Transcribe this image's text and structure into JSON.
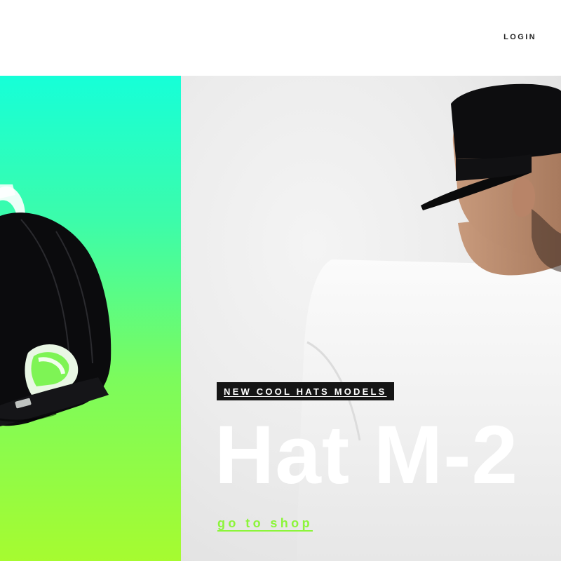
{
  "header": {
    "login_label": "LOGIN"
  },
  "hero": {
    "tag": "NEW COOL HATS MODELS",
    "title": "Hat M-2",
    "cta": "go to shop"
  },
  "colors": {
    "gradient_top": "#16ffd8",
    "gradient_bottom": "#a6fb30",
    "accent_green": "#8cf53a",
    "tag_background": "#151515"
  }
}
